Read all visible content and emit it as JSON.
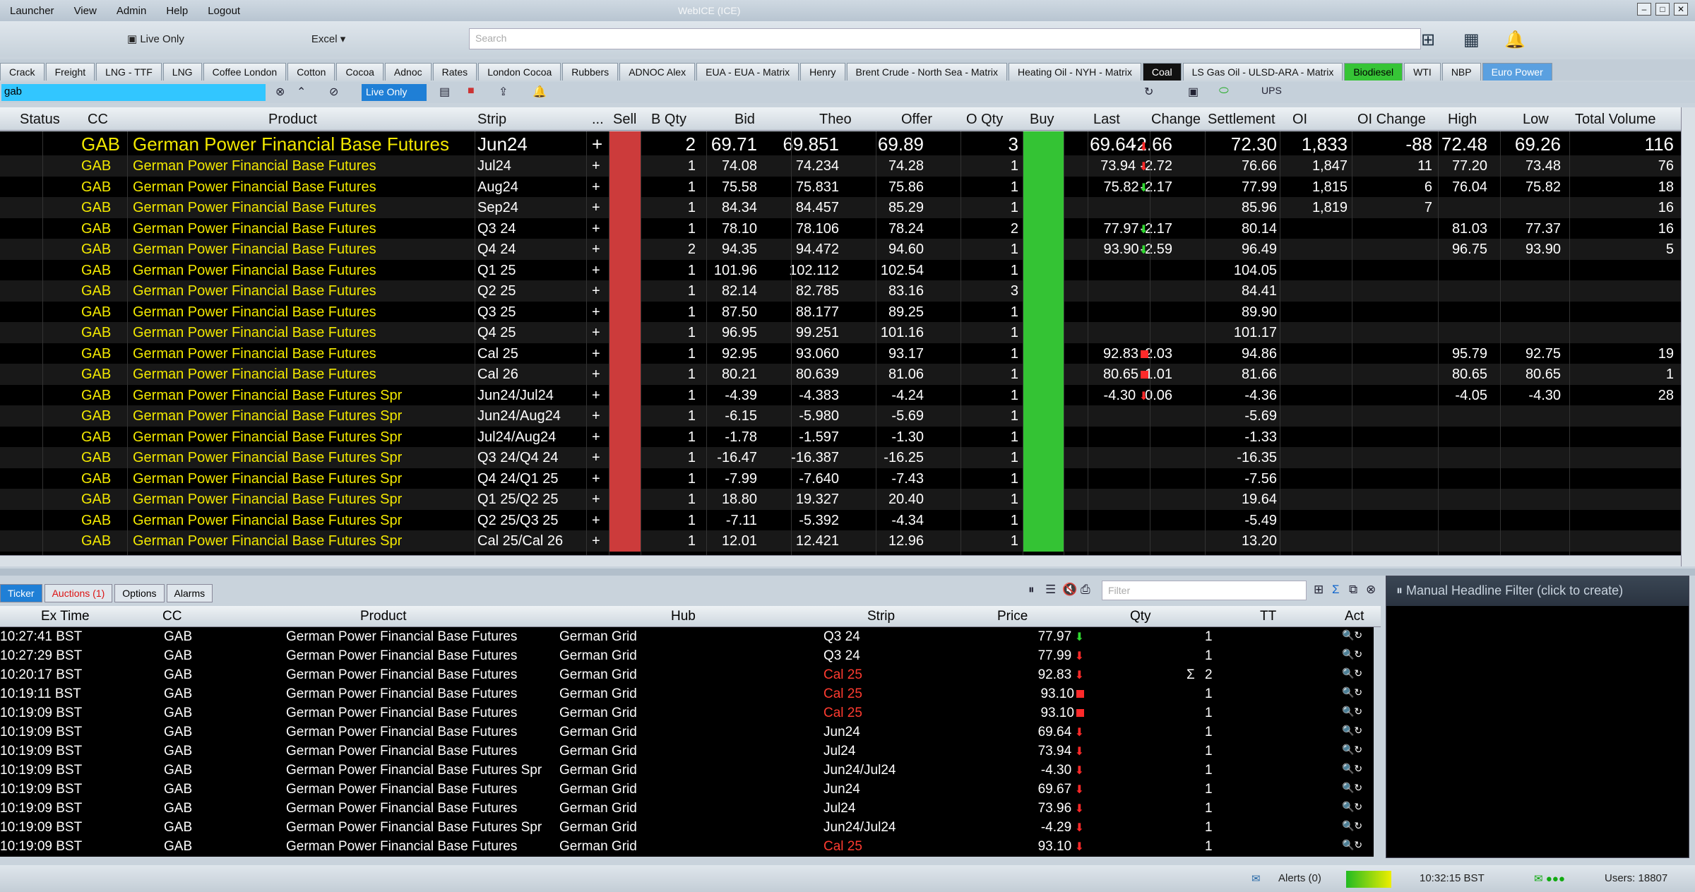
{
  "menu": {
    "items": [
      "Launcher",
      "View",
      "Admin",
      "Help",
      "Logout"
    ],
    "title": "WebICE (ICE)"
  },
  "toolbar": {
    "live_only": "Live Only",
    "excel": "Excel",
    "search_placeholder": "Search"
  },
  "tabs": [
    "Crack",
    "Freight",
    "LNG - TTF",
    "LNG",
    "Coffee London",
    "Cotton",
    "Cocoa",
    "Adnoc",
    "Rates",
    "London Cocoa",
    "Rubbers",
    "ADNOC Alex",
    "EUA - EUA - Matrix",
    "Henry",
    "Brent Crude - North Sea - Matrix",
    "Heating Oil - NYH - Matrix",
    "Coal",
    "LS Gas Oil - ULSD-ARA - Matrix",
    "Biodiesel",
    "WTI",
    "NBP",
    "Euro Power"
  ],
  "filter": {
    "value": "gab",
    "live_only": "Live Only",
    "ups": "UPS"
  },
  "columns": [
    "Status",
    "CC",
    "Product",
    "Strip",
    "...",
    "Sell",
    "B Qty",
    "Bid",
    "Theo",
    "Offer",
    "O Qty",
    "Buy",
    "Last",
    "Change",
    "Settlement",
    "OI",
    "OI Change",
    "High",
    "Low",
    "Total Volume"
  ],
  "rows": [
    {
      "cc": "GAB",
      "product": "German Power Financial Base Futures",
      "strip": "Jun24",
      "plus": "+",
      "bqty": "2",
      "bid": "69.71",
      "theo": "69.851",
      "offer": "69.89",
      "oqty": "3",
      "last": "69.64",
      "dir": "down",
      "change": "-2.66",
      "settle": "72.30",
      "oi": "1,833",
      "oich": "-88",
      "high": "72.48",
      "low": "69.26",
      "vol": "116"
    },
    {
      "cc": "GAB",
      "product": "German Power Financial Base Futures",
      "strip": "Jul24",
      "plus": "+",
      "bqty": "1",
      "bid": "74.08",
      "theo": "74.234",
      "offer": "74.28",
      "oqty": "1",
      "last": "73.94",
      "dir": "down",
      "change": "-2.72",
      "settle": "76.66",
      "oi": "1,847",
      "oich": "11",
      "high": "77.20",
      "low": "73.48",
      "vol": "76"
    },
    {
      "cc": "GAB",
      "product": "German Power Financial Base Futures",
      "strip": "Aug24",
      "plus": "+",
      "bqty": "1",
      "bid": "75.58",
      "theo": "75.831",
      "offer": "75.86",
      "oqty": "1",
      "last": "75.82",
      "dir": "up",
      "change": "-2.17",
      "settle": "77.99",
      "oi": "1,815",
      "oich": "6",
      "high": "76.04",
      "low": "75.82",
      "vol": "18"
    },
    {
      "cc": "GAB",
      "product": "German Power Financial Base Futures",
      "strip": "Sep24",
      "plus": "+",
      "bqty": "1",
      "bid": "84.34",
      "theo": "84.457",
      "offer": "85.29",
      "oqty": "1",
      "last": "",
      "dir": "",
      "change": "",
      "settle": "85.96",
      "oi": "1,819",
      "oich": "7",
      "high": "",
      "low": "",
      "vol": "16"
    },
    {
      "cc": "GAB",
      "product": "German Power Financial Base Futures",
      "strip": "Q3 24",
      "plus": "+",
      "bqty": "1",
      "bid": "78.10",
      "theo": "78.106",
      "offer": "78.24",
      "oqty": "2",
      "last": "77.97",
      "dir": "up",
      "change": "-2.17",
      "settle": "80.14",
      "oi": "",
      "oich": "",
      "high": "81.03",
      "low": "77.37",
      "vol": "16"
    },
    {
      "cc": "GAB",
      "product": "German Power Financial Base Futures",
      "strip": "Q4 24",
      "plus": "+",
      "bqty": "2",
      "bid": "94.35",
      "theo": "94.472",
      "offer": "94.60",
      "oqty": "1",
      "last": "93.90",
      "dir": "up",
      "change": "-2.59",
      "settle": "96.49",
      "oi": "",
      "oich": "",
      "high": "96.75",
      "low": "93.90",
      "vol": "5"
    },
    {
      "cc": "GAB",
      "product": "German Power Financial Base Futures",
      "strip": "Q1 25",
      "plus": "+",
      "bqty": "1",
      "bid": "101.96",
      "theo": "102.112",
      "offer": "102.54",
      "oqty": "1",
      "last": "",
      "dir": "",
      "change": "",
      "settle": "104.05",
      "oi": "",
      "oich": "",
      "high": "",
      "low": "",
      "vol": ""
    },
    {
      "cc": "GAB",
      "product": "German Power Financial Base Futures",
      "strip": "Q2 25",
      "plus": "+",
      "bqty": "1",
      "bid": "82.14",
      "theo": "82.785",
      "offer": "83.16",
      "oqty": "3",
      "last": "",
      "dir": "",
      "change": "",
      "settle": "84.41",
      "oi": "",
      "oich": "",
      "high": "",
      "low": "",
      "vol": ""
    },
    {
      "cc": "GAB",
      "product": "German Power Financial Base Futures",
      "strip": "Q3 25",
      "plus": "+",
      "bqty": "1",
      "bid": "87.50",
      "theo": "88.177",
      "offer": "89.25",
      "oqty": "1",
      "last": "",
      "dir": "",
      "change": "",
      "settle": "89.90",
      "oi": "",
      "oich": "",
      "high": "",
      "low": "",
      "vol": ""
    },
    {
      "cc": "GAB",
      "product": "German Power Financial Base Futures",
      "strip": "Q4 25",
      "plus": "+",
      "bqty": "1",
      "bid": "96.95",
      "theo": "99.251",
      "offer": "101.16",
      "oqty": "1",
      "last": "",
      "dir": "",
      "change": "",
      "settle": "101.17",
      "oi": "",
      "oich": "",
      "high": "",
      "low": "",
      "vol": ""
    },
    {
      "cc": "GAB",
      "product": "German Power Financial Base Futures",
      "strip": "Cal 25",
      "plus": "+",
      "bqty": "1",
      "bid": "92.95",
      "theo": "93.060",
      "offer": "93.17",
      "oqty": "1",
      "last": "92.83",
      "dir": "sq",
      "change": "-2.03",
      "settle": "94.86",
      "oi": "",
      "oich": "",
      "high": "95.79",
      "low": "92.75",
      "vol": "19"
    },
    {
      "cc": "GAB",
      "product": "German Power Financial Base Futures",
      "strip": "Cal 26",
      "plus": "+",
      "bqty": "1",
      "bid": "80.21",
      "theo": "80.639",
      "offer": "81.06",
      "oqty": "1",
      "last": "80.65",
      "dir": "sq",
      "change": "-1.01",
      "settle": "81.66",
      "oi": "",
      "oich": "",
      "high": "80.65",
      "low": "80.65",
      "vol": "1"
    },
    {
      "cc": "GAB",
      "product": "German Power Financial Base Futures Spr",
      "strip": "Jun24/Jul24",
      "plus": "+",
      "bqty": "1",
      "bid": "-4.39",
      "theo": "-4.383",
      "offer": "-4.24",
      "oqty": "1",
      "last": "-4.30",
      "dir": "down",
      "change": "0.06",
      "settle": "-4.36",
      "oi": "",
      "oich": "",
      "high": "-4.05",
      "low": "-4.30",
      "vol": "28"
    },
    {
      "cc": "GAB",
      "product": "German Power Financial Base Futures Spr",
      "strip": "Jun24/Aug24",
      "plus": "+",
      "bqty": "1",
      "bid": "-6.15",
      "theo": "-5.980",
      "offer": "-5.69",
      "oqty": "1",
      "last": "",
      "dir": "",
      "change": "",
      "settle": "-5.69",
      "oi": "",
      "oich": "",
      "high": "",
      "low": "",
      "vol": ""
    },
    {
      "cc": "GAB",
      "product": "German Power Financial Base Futures Spr",
      "strip": "Jul24/Aug24",
      "plus": "+",
      "bqty": "1",
      "bid": "-1.78",
      "theo": "-1.597",
      "offer": "-1.30",
      "oqty": "1",
      "last": "",
      "dir": "",
      "change": "",
      "settle": "-1.33",
      "oi": "",
      "oich": "",
      "high": "",
      "low": "",
      "vol": ""
    },
    {
      "cc": "GAB",
      "product": "German Power Financial Base Futures Spr",
      "strip": "Q3 24/Q4 24",
      "plus": "+",
      "bqty": "1",
      "bid": "-16.47",
      "theo": "-16.387",
      "offer": "-16.25",
      "oqty": "1",
      "last": "",
      "dir": "",
      "change": "",
      "settle": "-16.35",
      "oi": "",
      "oich": "",
      "high": "",
      "low": "",
      "vol": ""
    },
    {
      "cc": "GAB",
      "product": "German Power Financial Base Futures Spr",
      "strip": "Q4 24/Q1 25",
      "plus": "+",
      "bqty": "1",
      "bid": "-7.99",
      "theo": "-7.640",
      "offer": "-7.43",
      "oqty": "1",
      "last": "",
      "dir": "",
      "change": "",
      "settle": "-7.56",
      "oi": "",
      "oich": "",
      "high": "",
      "low": "",
      "vol": ""
    },
    {
      "cc": "GAB",
      "product": "German Power Financial Base Futures Spr",
      "strip": "Q1 25/Q2 25",
      "plus": "+",
      "bqty": "1",
      "bid": "18.80",
      "theo": "19.327",
      "offer": "20.40",
      "oqty": "1",
      "last": "",
      "dir": "",
      "change": "",
      "settle": "19.64",
      "oi": "",
      "oich": "",
      "high": "",
      "low": "",
      "vol": ""
    },
    {
      "cc": "GAB",
      "product": "German Power Financial Base Futures Spr",
      "strip": "Q2 25/Q3 25",
      "plus": "+",
      "bqty": "1",
      "bid": "-7.11",
      "theo": "-5.392",
      "offer": "-4.34",
      "oqty": "1",
      "last": "",
      "dir": "",
      "change": "",
      "settle": "-5.49",
      "oi": "",
      "oich": "",
      "high": "",
      "low": "",
      "vol": ""
    },
    {
      "cc": "GAB",
      "product": "German Power Financial Base Futures Spr",
      "strip": "Cal 25/Cal 26",
      "plus": "+",
      "bqty": "1",
      "bid": "12.01",
      "theo": "12.421",
      "offer": "12.96",
      "oqty": "1",
      "last": "",
      "dir": "",
      "change": "",
      "settle": "13.20",
      "oi": "",
      "oich": "",
      "high": "",
      "low": "",
      "vol": ""
    }
  ],
  "bottom_tabs": [
    "Ticker",
    "Auctions (1)",
    "Options",
    "Alarms"
  ],
  "bottom_filter_placeholder": "Filter",
  "ticker_columns": [
    "Ex Time",
    "CC",
    "Product",
    "Hub",
    "Strip",
    "Price",
    "Qty",
    "TT",
    "Act"
  ],
  "ticker": [
    {
      "time": "10:27:41 BST",
      "cc": "GAB",
      "product": "German Power Financial Base Futures",
      "hub": "German Grid",
      "strip": "Q3 24",
      "price": "77.97",
      "dir": "up",
      "qty": "1",
      "red": false
    },
    {
      "time": "10:27:29 BST",
      "cc": "GAB",
      "product": "German Power Financial Base Futures",
      "hub": "German Grid",
      "strip": "Q3 24",
      "price": "77.99",
      "dir": "down",
      "qty": "1",
      "red": false
    },
    {
      "time": "10:20:17 BST",
      "cc": "GAB",
      "product": "German Power Financial Base Futures",
      "hub": "German Grid",
      "strip": "Cal 25",
      "price": "92.83",
      "dir": "down",
      "qty": "2",
      "sigma": "Σ",
      "red": true
    },
    {
      "time": "10:19:11 BST",
      "cc": "GAB",
      "product": "German Power Financial Base Futures",
      "hub": "German Grid",
      "strip": "Cal 25",
      "price": "93.10",
      "dir": "sq",
      "qty": "1",
      "red": true
    },
    {
      "time": "10:19:09 BST",
      "cc": "GAB",
      "product": "German Power Financial Base Futures",
      "hub": "German Grid",
      "strip": "Cal 25",
      "price": "93.10",
      "dir": "sq",
      "qty": "1",
      "red": true
    },
    {
      "time": "10:19:09 BST",
      "cc": "GAB",
      "product": "German Power Financial Base Futures",
      "hub": "German Grid",
      "strip": "Jun24",
      "price": "69.64",
      "dir": "down",
      "qty": "1",
      "red": false
    },
    {
      "time": "10:19:09 BST",
      "cc": "GAB",
      "product": "German Power Financial Base Futures",
      "hub": "German Grid",
      "strip": "Jul24",
      "price": "73.94",
      "dir": "down",
      "qty": "1",
      "red": false
    },
    {
      "time": "10:19:09 BST",
      "cc": "GAB",
      "product": "German Power Financial Base Futures Spr",
      "hub": "German Grid",
      "strip": "Jun24/Jul24",
      "price": "-4.30",
      "dir": "down",
      "qty": "1",
      "red": false
    },
    {
      "time": "10:19:09 BST",
      "cc": "GAB",
      "product": "German Power Financial Base Futures",
      "hub": "German Grid",
      "strip": "Jun24",
      "price": "69.67",
      "dir": "down",
      "qty": "1",
      "red": false
    },
    {
      "time": "10:19:09 BST",
      "cc": "GAB",
      "product": "German Power Financial Base Futures",
      "hub": "German Grid",
      "strip": "Jul24",
      "price": "73.96",
      "dir": "down",
      "qty": "1",
      "red": false
    },
    {
      "time": "10:19:09 BST",
      "cc": "GAB",
      "product": "German Power Financial Base Futures Spr",
      "hub": "German Grid",
      "strip": "Jun24/Jul24",
      "price": "-4.29",
      "dir": "down",
      "qty": "1",
      "red": false
    },
    {
      "time": "10:19:09 BST",
      "cc": "GAB",
      "product": "German Power Financial Base Futures",
      "hub": "German Grid",
      "strip": "Cal 25",
      "price": "93.10",
      "dir": "down",
      "qty": "1",
      "red": true
    }
  ],
  "headline": {
    "label": "Manual Headline Filter  (click to create)"
  },
  "status": {
    "alerts": "Alerts (0)",
    "time": "10:32:15 BST",
    "users": "Users: 18807"
  },
  "colors": {
    "yellow": "#f2e800",
    "sell": "#cc3b3b",
    "buy": "#34c334",
    "down": "#ff2a2a",
    "up": "#2fd82f"
  }
}
